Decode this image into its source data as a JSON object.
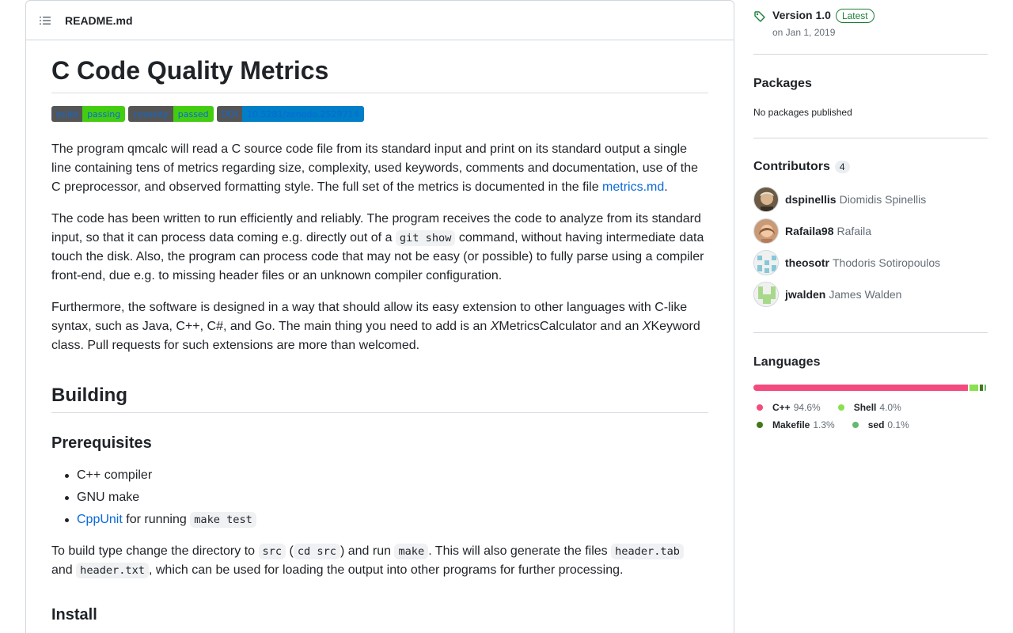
{
  "readme": {
    "filename": "README.md",
    "title": "C Code Quality Metrics",
    "badges": [
      {
        "left": "build",
        "right": "passing",
        "color": "#44cc11"
      },
      {
        "left": "coverity",
        "right": "passed",
        "color": "#44cc11"
      },
      {
        "left": "DOI",
        "right": "10.5281/zenodo.2529714",
        "color": "#007ec6"
      }
    ],
    "p1_text": "The program qmcalc will read a C source code file from its standard input and print on its standard output a single line containing tens of metrics regarding size, complexity, used keywords, comments and documentation, use of the C preprocessor, and observed formatting style. The full set of the metrics is documented in the file ",
    "p1_link": "metrics.md",
    "p1_end": ".",
    "p2_a": "The code has been written to run efficiently and reliably. The program receives the code to analyze from its standard input, so that it can process data coming e.g. directly out of a ",
    "p2_code": "git show",
    "p2_b": " command, without having intermediate data touch the disk. Also, the program can process code that may not be easy (or possible) to fully parse using a compiler front-end, due e.g. to missing header files or an unknown compiler configuration.",
    "p3_a": "Furthermore, the software is designed in a way that should allow its easy extension to other languages with C-like syntax, such as Java, C++, C#, and Go. The main thing you need to add is an ",
    "p3_x1": "X",
    "p3_b": "MetricsCalculator and an ",
    "p3_x2": "X",
    "p3_c": "Keyword class. Pull requests for such extensions are more than welcomed.",
    "h_building": "Building",
    "h_prereq": "Prerequisites",
    "prereq_items": {
      "item1": "C++ compiler",
      "item2": "GNU make",
      "item3_link": "CppUnit",
      "item3_text": " for running ",
      "item3_code": "make test"
    },
    "p4_a": "To build type change the directory to ",
    "p4_code1": "src",
    "p4_b": " (",
    "p4_code2": "cd src",
    "p4_c": ") and run ",
    "p4_code3": "make",
    "p4_d": ". This will also generate the files ",
    "p4_code4": "header.tab",
    "p4_e": " and ",
    "p4_code5": "header.txt",
    "p4_f": ", which can be used for loading the output into other programs for further processing.",
    "h_install": "Install"
  },
  "sidebar": {
    "release": {
      "title": "Version 1.0",
      "badge": "Latest",
      "date": "on Jan 1, 2019"
    },
    "packages": {
      "title": "Packages",
      "text": "No packages published"
    },
    "contributors": {
      "title": "Contributors",
      "count": "4",
      "list": [
        {
          "login": "dspinellis",
          "name": "Diomidis Spinellis"
        },
        {
          "login": "Rafaila98",
          "name": "Rafaila"
        },
        {
          "login": "theosotr",
          "name": "Thodoris Sotiropoulos"
        },
        {
          "login": "jwalden",
          "name": "James Walden"
        }
      ]
    },
    "languages": {
      "title": "Languages",
      "list": [
        {
          "name": "C++",
          "percent": "94.6%",
          "value": 94.6,
          "color": "#f34b7d"
        },
        {
          "name": "Shell",
          "percent": "4.0%",
          "value": 4.0,
          "color": "#89e051"
        },
        {
          "name": "Makefile",
          "percent": "1.3%",
          "value": 1.3,
          "color": "#427819"
        },
        {
          "name": "sed",
          "percent": "0.1%",
          "value": 0.1,
          "color": "#64b970"
        }
      ]
    }
  }
}
